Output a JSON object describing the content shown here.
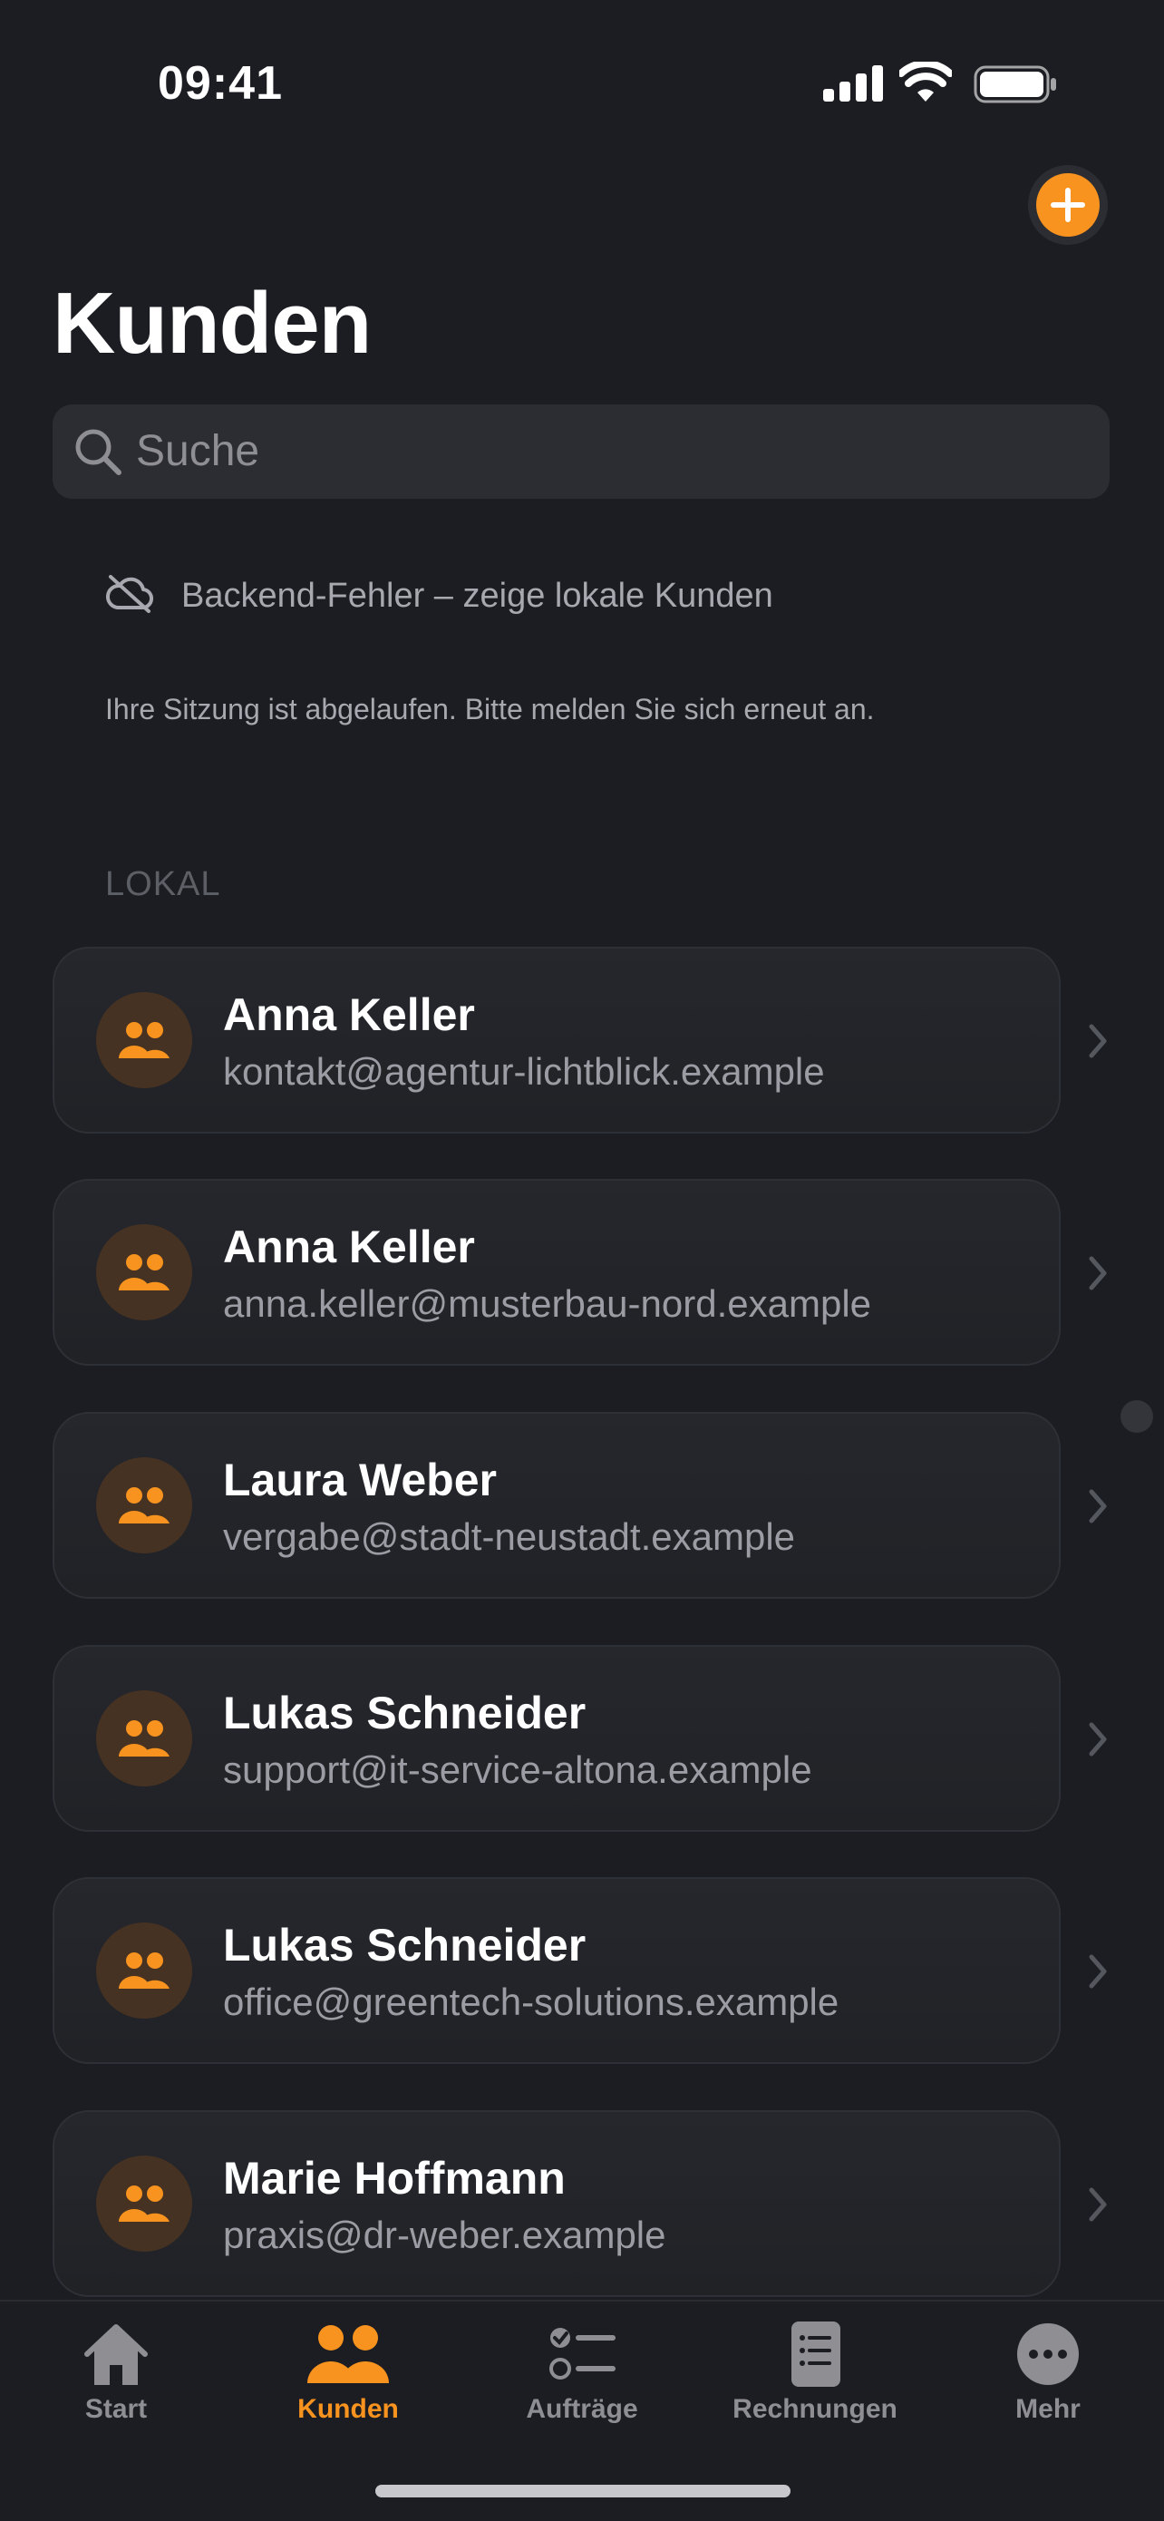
{
  "status_bar": {
    "time": "09:41"
  },
  "header": {
    "title": "Kunden",
    "add_icon": "plus-circle-icon"
  },
  "search": {
    "placeholder": "Suche"
  },
  "banner": {
    "message": "Backend-Fehler – zeige lokale Kunden",
    "session_message": "Ihre Sitzung ist abgelaufen. Bitte melden Sie sich erneut an."
  },
  "section": {
    "title": "LOKAL"
  },
  "customers": [
    {
      "name": "Anna Keller",
      "email": "kontakt@agentur-lichtblick.example"
    },
    {
      "name": "Anna Keller",
      "email": "anna.keller@musterbau-nord.example"
    },
    {
      "name": "Laura Weber",
      "email": "vergabe@stadt-neustadt.example"
    },
    {
      "name": "Lukas Schneider",
      "email": "support@it-service-altona.example"
    },
    {
      "name": "Lukas Schneider",
      "email": "office@greentech-solutions.example"
    },
    {
      "name": "Marie Hoffmann",
      "email": "praxis@dr-weber.example"
    }
  ],
  "tabs": [
    {
      "label": "Start",
      "icon": "house-icon",
      "active": false
    },
    {
      "label": "Kunden",
      "icon": "people-icon",
      "active": true
    },
    {
      "label": "Aufträge",
      "icon": "checklist-icon",
      "active": false
    },
    {
      "label": "Rechnungen",
      "icon": "document-list-icon",
      "active": false
    },
    {
      "label": "Mehr",
      "icon": "ellipsis-circle-icon",
      "active": false
    }
  ],
  "colors": {
    "accent": "#f7931e",
    "background": "#1c1d22",
    "card": "#24262c"
  }
}
